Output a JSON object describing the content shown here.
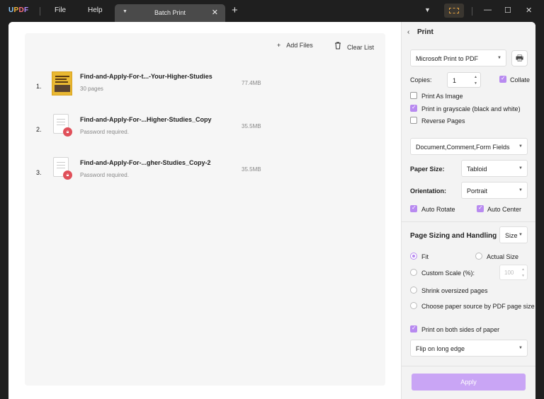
{
  "app": {
    "logo": {
      "u": "U",
      "p": "P",
      "d": "D",
      "f": "F"
    },
    "menu": {
      "file": "File",
      "help": "Help"
    },
    "tab": {
      "title": "Batch Print",
      "close": "✕"
    },
    "new_tab": "+",
    "window": {
      "minimize": "—",
      "maximize": "☐",
      "close": "✕"
    }
  },
  "toolbar": {
    "add_files": "Add Files",
    "clear_list": "Clear List"
  },
  "files": [
    {
      "index": "1.",
      "name": "Find-and-Apply-For-t...-Your-Higher-Studies",
      "sub": "30 pages",
      "size": "77.4MB",
      "locked": false
    },
    {
      "index": "2.",
      "name": "Find-and-Apply-For-...Higher-Studies_Copy",
      "sub": "Password required.",
      "size": "35.5MB",
      "locked": true
    },
    {
      "index": "3.",
      "name": "Find-and-Apply-For-...gher-Studies_Copy-2",
      "sub": "Password required.",
      "size": "35.5MB",
      "locked": true
    }
  ],
  "print_panel": {
    "back": "‹",
    "title": "Print",
    "printer": "Microsoft Print to PDF",
    "copies_label": "Copies:",
    "copies_value": "1",
    "collate": "Collate",
    "print_as_image": "Print As Image",
    "grayscale": "Print in grayscale (black and white)",
    "reverse": "Reverse Pages",
    "content": "Document,Comment,Form Fields",
    "paper_size_label": "Paper Size:",
    "paper_size": "Tabloid",
    "orientation_label": "Orientation:",
    "orientation": "Portrait",
    "auto_rotate": "Auto Rotate",
    "auto_center": "Auto Center",
    "sizing_title": "Page Sizing and Handling",
    "sizing_mode": "Size",
    "fit": "Fit",
    "actual_size": "Actual Size",
    "custom_scale": "Custom Scale (%):",
    "custom_scale_value": "100",
    "shrink": "Shrink oversized pages",
    "paper_source": "Choose paper source by PDF page size",
    "both_sides": "Print on both sides of paper",
    "flip": "Flip on long edge",
    "apply": "Apply"
  },
  "colors": {
    "accent": "#b88af0",
    "apply_bg": "#c9a5f5",
    "titlebar": "#1f1f1f",
    "lock": "#e0505a"
  }
}
